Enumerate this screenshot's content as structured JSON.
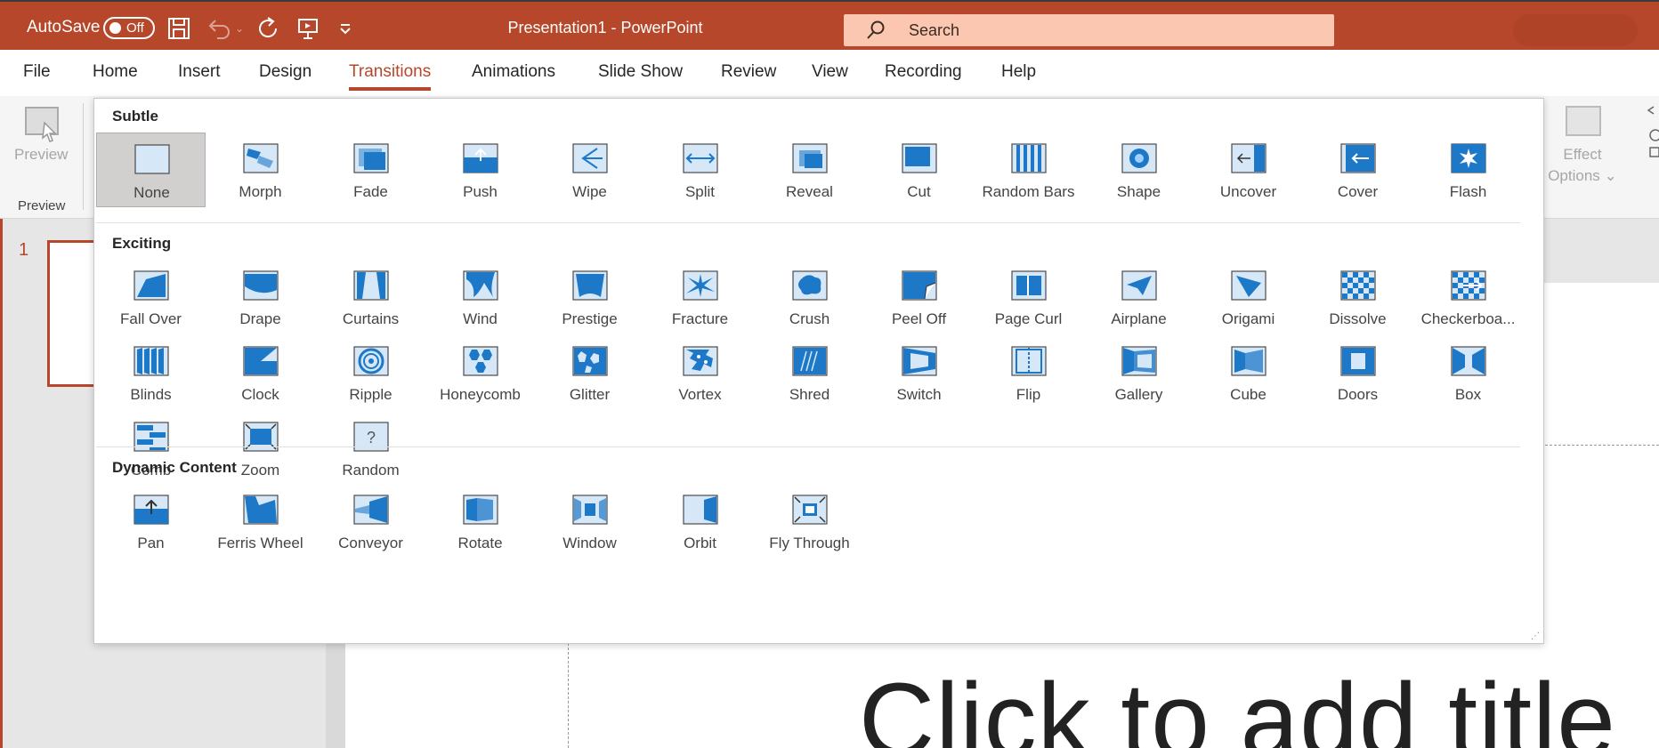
{
  "titlebar": {
    "autosave_label": "AutoSave",
    "autosave_state": "Off",
    "title": "Presentation1  -  PowerPoint",
    "search_placeholder": "Search",
    "icons": [
      "save-icon",
      "undo-icon",
      "redo-icon",
      "present-icon",
      "customize-qat-icon"
    ]
  },
  "tabs": [
    "File",
    "Home",
    "Insert",
    "Design",
    "Transitions",
    "Animations",
    "Slide Show",
    "Review",
    "View",
    "Recording",
    "Help"
  ],
  "active_tab": "Transitions",
  "ribbon": {
    "preview_label": "Preview",
    "preview_group_label": "Preview",
    "effect_options_label": "Effect Options",
    "effect_options_chevron": "⌄"
  },
  "gallery": {
    "sections": [
      {
        "title": "Subtle",
        "items": [
          "None",
          "Morph",
          "Fade",
          "Push",
          "Wipe",
          "Split",
          "Reveal",
          "Cut",
          "Random Bars",
          "Shape",
          "Uncover",
          "Cover",
          "Flash"
        ]
      },
      {
        "title": "Exciting",
        "items": [
          "Fall Over",
          "Drape",
          "Curtains",
          "Wind",
          "Prestige",
          "Fracture",
          "Crush",
          "Peel Off",
          "Page Curl",
          "Airplane",
          "Origami",
          "Dissolve",
          "Checkerboa...",
          "Blinds",
          "Clock",
          "Ripple",
          "Honeycomb",
          "Glitter",
          "Vortex",
          "Shred",
          "Switch",
          "Flip",
          "Gallery",
          "Cube",
          "Doors",
          "Box",
          "Comb",
          "Zoom",
          "Random"
        ]
      },
      {
        "title": "Dynamic Content",
        "items": [
          "Pan",
          "Ferris Wheel",
          "Conveyor",
          "Rotate",
          "Window",
          "Orbit",
          "Fly Through"
        ]
      }
    ],
    "selected_item": "None"
  },
  "slide_pane": {
    "slide_number": "1"
  },
  "slide": {
    "title_placeholder": "Click to add title"
  },
  "colors": {
    "accent": "#b7472a",
    "search_bg": "#fcc7b0",
    "icon_blue": "#1e78c8",
    "icon_light": "#d6e8f8"
  }
}
